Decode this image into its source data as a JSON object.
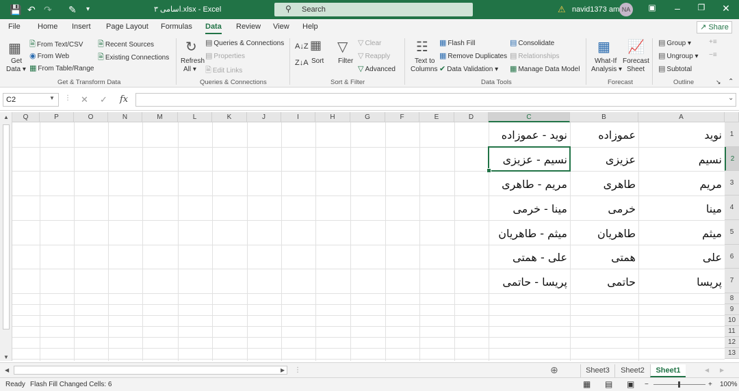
{
  "titlebar": {
    "title": "اسامی ۳.xlsx - Excel",
    "search_label": "Search",
    "user_name": "navid1373 amz",
    "user_initials": "NA"
  },
  "tabs": [
    "File",
    "Home",
    "Insert",
    "Page Layout",
    "Formulas",
    "Data",
    "Review",
    "View",
    "Help"
  ],
  "active_tab": "Data",
  "share_label": "Share",
  "ribbon": {
    "get_data": {
      "line1": "Get",
      "line2": "Data"
    },
    "from_text_csv": "From Text/CSV",
    "from_web": "From Web",
    "from_table_range": "From Table/Range",
    "recent_sources": "Recent Sources",
    "existing_connections": "Existing Connections",
    "group_get_transform": "Get & Transform Data",
    "refresh": {
      "line1": "Refresh",
      "line2": "All"
    },
    "queries_connections": "Queries & Connections",
    "properties": "Properties",
    "edit_links": "Edit Links",
    "group_queries": "Queries & Connections",
    "sort": "Sort",
    "filter": "Filter",
    "clear": "Clear",
    "reapply": "Reapply",
    "advanced": "Advanced",
    "group_sort_filter": "Sort & Filter",
    "text_to_columns": {
      "line1": "Text to",
      "line2": "Columns"
    },
    "flash_fill": "Flash Fill",
    "remove_duplicates": "Remove Duplicates",
    "data_validation": "Data Validation",
    "consolidate": "Consolidate",
    "relationships": "Relationships",
    "manage_data_model": "Manage Data Model",
    "group_data_tools": "Data Tools",
    "what_if": {
      "line1": "What-If",
      "line2": "Analysis"
    },
    "forecast_sheet": {
      "line1": "Forecast",
      "line2": "Sheet"
    },
    "group_forecast": "Forecast",
    "group_btn": "Group",
    "ungroup_btn": "Ungroup",
    "subtotal": "Subtotal",
    "group_outline": "Outline"
  },
  "formula_bar": {
    "name_box": "C2",
    "fx": "fx",
    "formula": ""
  },
  "grid": {
    "columns": [
      "Q",
      "P",
      "O",
      "N",
      "M",
      "L",
      "K",
      "J",
      "I",
      "H",
      "G",
      "F",
      "E",
      "D",
      "C",
      "B",
      "A"
    ],
    "rows": [
      "1",
      "2",
      "3",
      "4",
      "5",
      "6",
      "7",
      "8",
      "9",
      "10",
      "11",
      "12",
      "13"
    ],
    "selected_column": "C",
    "selected_row": "2",
    "data": [
      {
        "a": "نوید",
        "b": "عموزاده",
        "c": "نوید - عموزاده"
      },
      {
        "a": "نسیم",
        "b": "عزیزی",
        "c": "نسیم - عزیزی"
      },
      {
        "a": "مریم",
        "b": "طاهری",
        "c": "مریم - طاهری"
      },
      {
        "a": "مینا",
        "b": "خرمی",
        "c": "مینا - خرمی"
      },
      {
        "a": "میثم",
        "b": "طاهریان",
        "c": "میثم - طاهریان"
      },
      {
        "a": "علی",
        "b": "همتی",
        "c": "علی - همتی"
      },
      {
        "a": "پریسا",
        "b": "حاتمی",
        "c": "پریسا - حاتمی"
      }
    ]
  },
  "sheets": [
    "Sheet3",
    "Sheet2",
    "Sheet1"
  ],
  "active_sheet": "Sheet1",
  "status": {
    "ready": "Ready",
    "message": "Flash Fill Changed Cells: 6",
    "zoom": "100%"
  }
}
